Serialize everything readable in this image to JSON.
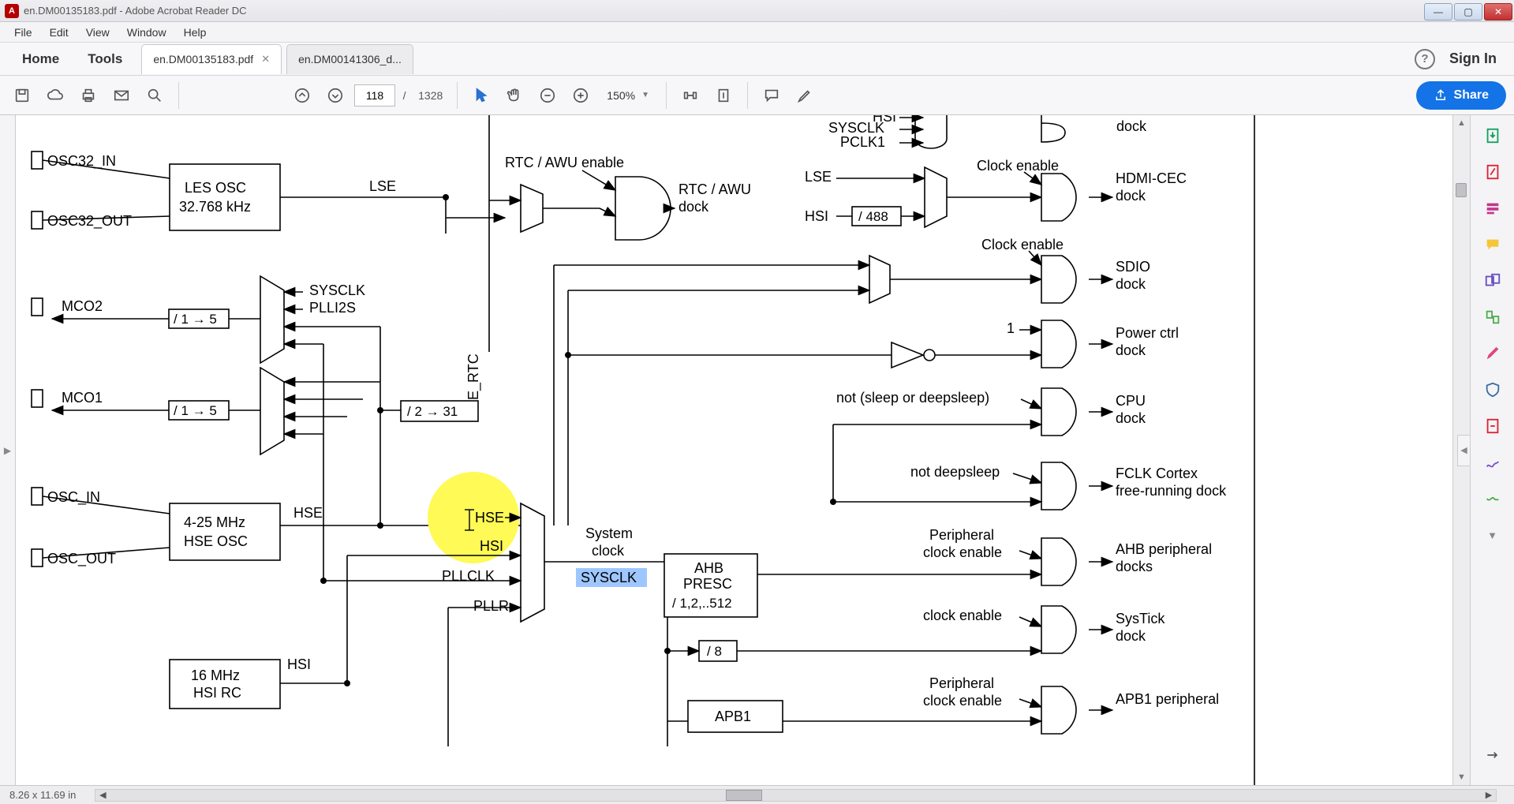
{
  "window": {
    "title": "en.DM00135183.pdf - Adobe Acrobat Reader DC"
  },
  "menu": {
    "file": "File",
    "edit": "Edit",
    "view": "View",
    "window": "Window",
    "help": "Help"
  },
  "tabs": {
    "home": "Home",
    "tools": "Tools",
    "docs": [
      {
        "label": "en.DM00135183.pdf",
        "closeable": true
      },
      {
        "label": "en.DM00141306_d...",
        "closeable": false
      }
    ],
    "signin": "Sign In"
  },
  "toolbar": {
    "page_current": "118",
    "page_sep": "/",
    "page_total": "1328",
    "zoom": "150%",
    "share": "Share"
  },
  "status": {
    "page_size": "8.26 x 11.69 in"
  },
  "diagram": {
    "pins": {
      "osc32_in": "OSC32_IN",
      "osc32_out": "OSC32_OUT",
      "mco2": "MCO2",
      "mco1": "MCO1",
      "osc_in": "OSC_IN",
      "osc_out": "OSC_OUT"
    },
    "blocks": {
      "les_osc_l1": "LES OSC",
      "les_osc_l2": "32.768 kHz",
      "hse_osc_l1": "4-25 MHz",
      "hse_osc_l2": "HSE OSC",
      "hsi_rc_l1": "16 MHz",
      "hsi_rc_l2": "HSI RC",
      "ahb_presc_l1": "AHB",
      "ahb_presc_l2": "PRESC",
      "ahb_presc_l3": "/ 1,2,..512",
      "apb1": "APB1",
      "div488": "/ 488",
      "mco1_div": "/ 1 → 5",
      "mco2_div": "/ 1 → 5",
      "hse_rtc_div": "/ 2 → 31",
      "systick_div": "/ 8"
    },
    "labels": {
      "lse": "LSE",
      "hse": "HSE",
      "hsi": "HSI",
      "hse_top": "HSI",
      "sysclk": "SYSCLK",
      "pclk1": "PCLK1",
      "pll_sysclk": "SYSCLK",
      "plli2s": "PLLI2S",
      "hse_mux": "HSE",
      "hsi_mux": "HSI",
      "pllclk": "PLLCLK",
      "pllr": "PLLR",
      "hse_rtc": "HSE_RTC",
      "rtc_awu_en": "RTC / AWU enable",
      "rtc_awu_clk": "RTC / AWU",
      "dock": "dock",
      "lse2": "LSE",
      "hsi2": "HSI",
      "clk_en": "Clock\nenable",
      "hdmi_l1": "HDMI-CEC",
      "clk_en2": "Clock\nenable",
      "sdio": "SDIO",
      "one": "1",
      "pwr_l1": "Power ctrl",
      "not_sleep": "not (sleep or deepsleep)",
      "cpu": "CPU",
      "not_deep": "not deepsleep",
      "fclk_l1": "FCLK Cortex",
      "fclk_l2": "free-running dock",
      "periph_en_l1": "Peripheral",
      "periph_en_l2": "clock enable",
      "ahb_periph_l1": "AHB peripheral",
      "ahb_periph_l2": "docks",
      "clk_en3": "clock enable",
      "systick_l1": "SysTick",
      "apb1_periph": "APB1 peripheral",
      "system_clock_l1": "System",
      "system_clock_l2": "clock",
      "sysclk_highlight": "SYSCLK"
    }
  }
}
